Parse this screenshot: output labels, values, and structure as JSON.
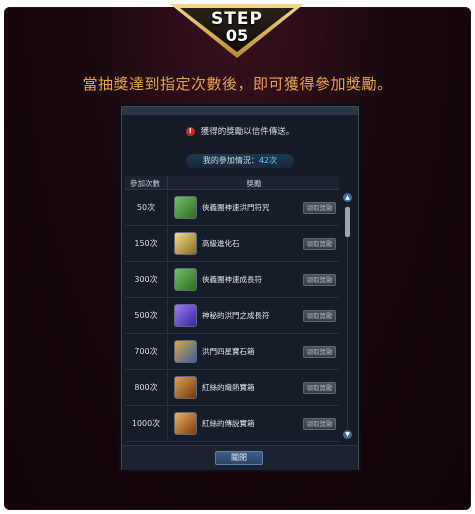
{
  "badge": {
    "step_label": "STEP",
    "step_number": "05"
  },
  "headline": "當抽獎達到指定次數後，即可獲得參加獎勵。",
  "dialog": {
    "notice": "獲得的獎勵以信件傳送。",
    "participation_label": "我的參加情況：",
    "participation_value": "42次",
    "columns": {
      "times": "參加次數",
      "reward": "獎勵"
    },
    "rows": [
      {
        "times": "50次",
        "reward": "俠義團神速洪門符咒",
        "claim": "領取獎勵",
        "icon": "green-talisman-icon",
        "color": "#3f8a3a"
      },
      {
        "times": "150次",
        "reward": "高級進化石",
        "claim": "領取獎勵",
        "icon": "gold-stone-icon",
        "color": "#a88834"
      },
      {
        "times": "300次",
        "reward": "俠義團神速成長符",
        "claim": "領取獎勵",
        "icon": "green-talisman-icon",
        "color": "#3f8a3a"
      },
      {
        "times": "500次",
        "reward": "神秘的洪門之成長符",
        "claim": "領取獎勵",
        "icon": "purple-talisman-icon",
        "color": "#5b3cbf"
      },
      {
        "times": "700次",
        "reward": "洪門四星寶石箱",
        "claim": "領取獎勵",
        "icon": "gem-box-icon",
        "color": "#3a5fa0"
      },
      {
        "times": "800次",
        "reward": "紅絲的熾熱寶箱",
        "claim": "領取獎勵",
        "icon": "treasure-chest-icon",
        "color": "#a8642a"
      },
      {
        "times": "1000次",
        "reward": "紅絲的傳說寶箱",
        "claim": "領取獎勵",
        "icon": "treasure-chest-icon",
        "color": "#b86a26"
      }
    ],
    "close_label": "關閉"
  }
}
